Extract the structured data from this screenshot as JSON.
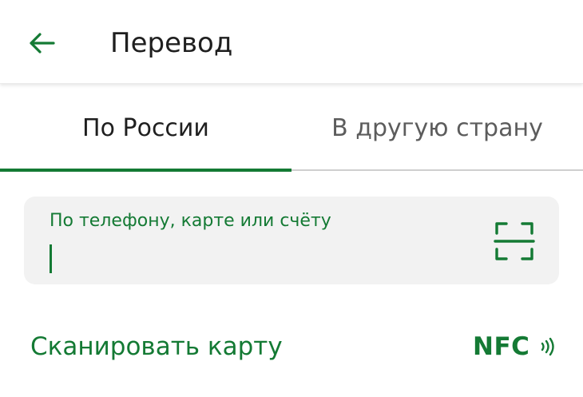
{
  "header": {
    "title": "Перевод",
    "back_icon": "arrow-left-icon"
  },
  "tabs": [
    {
      "label": "По России",
      "active": true
    },
    {
      "label": "В другую страну",
      "active": false
    }
  ],
  "recipient_field": {
    "label": "По телефону, карте или счёту",
    "value": "",
    "scan_icon": "qr-scan-icon"
  },
  "actions": {
    "scan_card_label": "Сканировать карту",
    "nfc_label": "NFC",
    "nfc_icon": "nfc-waves-icon"
  },
  "colors": {
    "accent": "#147a34",
    "text": "#1f1f1f",
    "muted": "#5c5c5c",
    "field_bg": "#f2f2f2"
  }
}
